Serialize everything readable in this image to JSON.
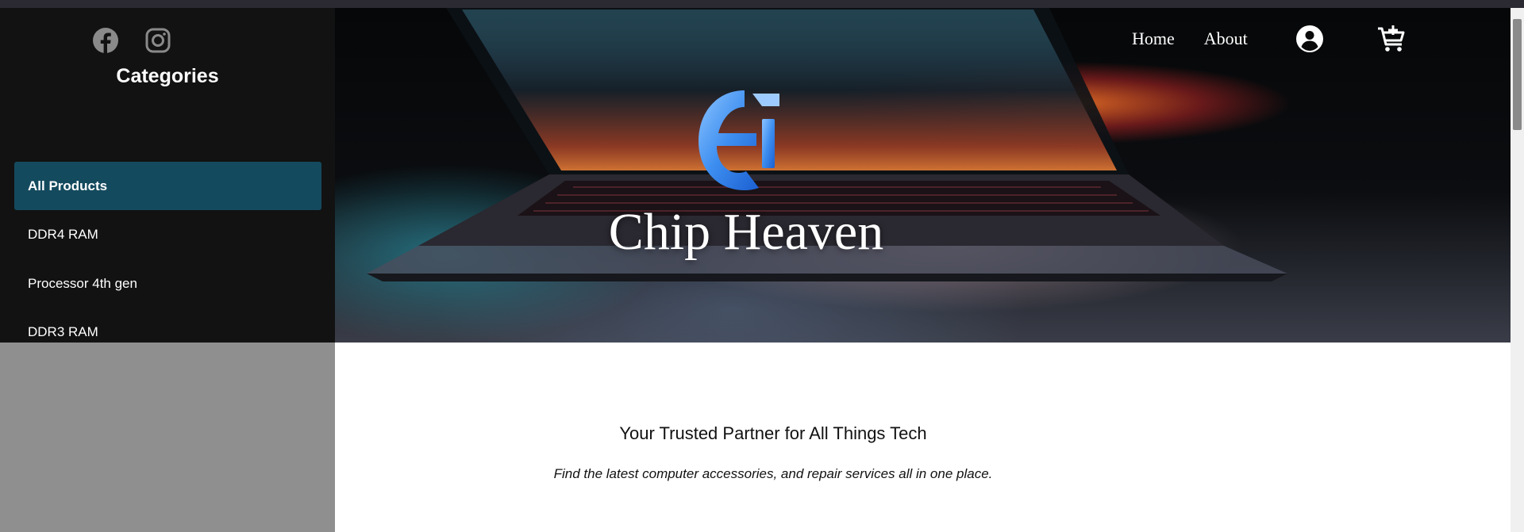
{
  "colors": {
    "sidebar_bg": "#121212",
    "active_item_bg": "#144a5e",
    "gray_panel": "#8f8f8f",
    "logo_blue": "#3d8ef0"
  },
  "social": {
    "icons": [
      "facebook-icon",
      "instagram-icon"
    ]
  },
  "sidebar": {
    "title": "Categories",
    "items": [
      {
        "label": "All Products",
        "active": true
      },
      {
        "label": "DDR4 RAM"
      },
      {
        "label": "Processor 4th gen"
      },
      {
        "label": "DDR3 RAM"
      }
    ]
  },
  "nav": {
    "home": "Home",
    "about": "About",
    "icons": [
      "account-icon",
      "cart-add-icon"
    ]
  },
  "hero": {
    "brand": "Chip Heaven"
  },
  "main": {
    "tagline": "Your Trusted Partner for All Things Tech",
    "subline": "Find the latest computer accessories, and repair services all in one place."
  }
}
